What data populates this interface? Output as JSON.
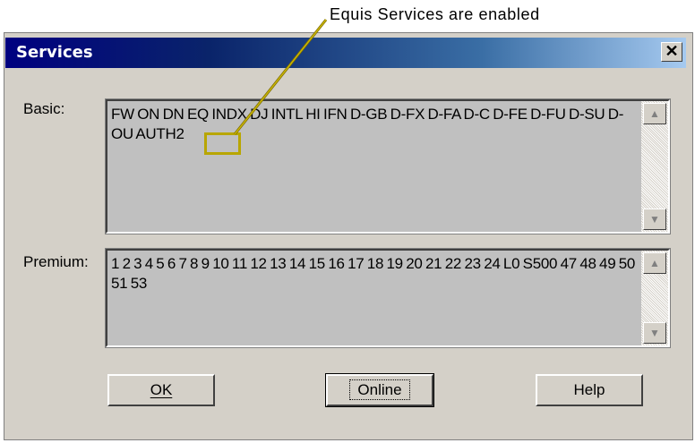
{
  "annotation": {
    "text": "Equis Services are enabled"
  },
  "dialog": {
    "title": "Services",
    "close_glyph": "✕",
    "basic": {
      "label": "Basic:",
      "text": "FW ON DN EQ INDX DJ INTL HI IFN D-GB D-FX D-FA D-C D-FE D-FU D-SU D-OU AUTH2"
    },
    "premium": {
      "label": "Premium:",
      "text": "1 2 3 4 5 6 7 8 9 10 11 12 13 14 15 16 17 18 19 20 21 22 23 24 L0 S500 47 48 49 50 51 53"
    },
    "buttons": {
      "ok": "OK",
      "online": "Online",
      "help": "Help"
    },
    "scroll_up": "▲",
    "scroll_down": "▼"
  },
  "colors": {
    "titlebar": "#0a246a",
    "dialog_bg": "#d4d0c8",
    "highlight": "#b8a600"
  }
}
